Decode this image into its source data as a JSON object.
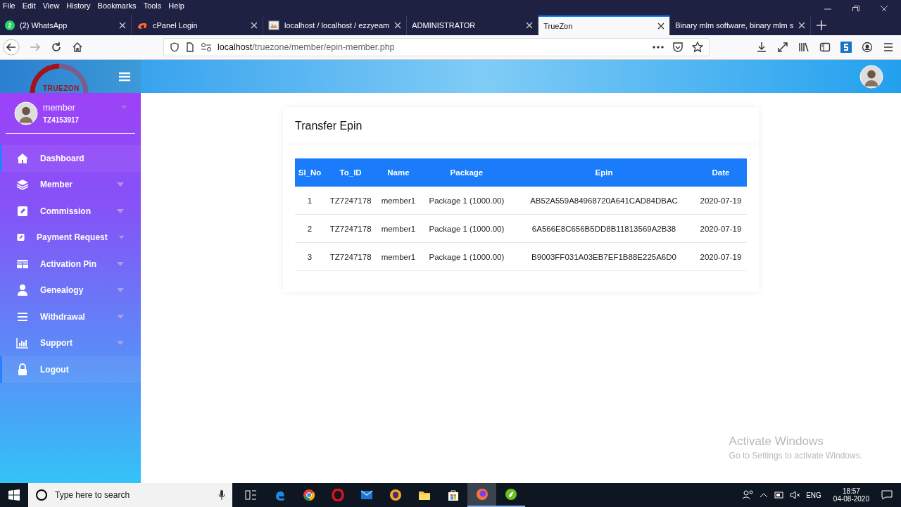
{
  "browser": {
    "menu": [
      "File",
      "Edit",
      "View",
      "History",
      "Bookmarks",
      "Tools",
      "Help"
    ],
    "tabs": [
      {
        "title": "(2) WhatsApp",
        "badge": "2",
        "selected": false
      },
      {
        "title": "cPanel Login",
        "selected": false
      },
      {
        "title": "localhost / localhost / ezzyeam",
        "selected": false
      },
      {
        "title": "ADMINISTRATOR",
        "selected": false
      },
      {
        "title": "TrueZon",
        "selected": true
      },
      {
        "title": "Binary mlm software, binary mlm s",
        "selected": false
      }
    ],
    "url": {
      "host": "localhost",
      "path": "/truezone/member/epin-member.php"
    }
  },
  "app": {
    "logo": "TRUEZON",
    "user": {
      "name": "member",
      "id": "TZ4153917"
    },
    "nav": [
      {
        "label": "Dashboard",
        "highlighted": true,
        "has_submenu": false
      },
      {
        "label": "Member",
        "highlighted": false,
        "has_submenu": true
      },
      {
        "label": "Commission",
        "highlighted": false,
        "has_submenu": true
      },
      {
        "label": "Payment Request",
        "highlighted": false,
        "has_submenu": true
      },
      {
        "label": "Activation Pin",
        "highlighted": false,
        "has_submenu": true
      },
      {
        "label": "Genealogy",
        "highlighted": false,
        "has_submenu": true
      },
      {
        "label": "Withdrawal",
        "highlighted": false,
        "has_submenu": true
      },
      {
        "label": "Support",
        "highlighted": false,
        "has_submenu": true
      },
      {
        "label": "Logout",
        "highlighted": true,
        "has_submenu": false
      }
    ],
    "card": {
      "title": "Transfer Epin",
      "table": {
        "columns": [
          "Sl_No",
          "To_ID",
          "Name",
          "Package",
          "Epin",
          "Date"
        ],
        "rows": [
          [
            "1",
            "TZ7247178",
            "member1",
            "Package 1 (1000.00)",
            "AB52A559A84968720A641CAD84DBAC",
            "2020-07-19"
          ],
          [
            "2",
            "TZ7247178",
            "member1",
            "Package 1 (1000.00)",
            "6A566E8C656B5DD8B11813569A2B38",
            "2020-07-19"
          ],
          [
            "3",
            "TZ7247178",
            "member1",
            "Package 1 (1000.00)",
            "B9003FF031A03EB7EF1B88E225A6D0",
            "2020-07-19"
          ]
        ]
      }
    }
  },
  "activation_notice": {
    "title": "Activate Windows",
    "text": "Go to Settings to activate Windows."
  },
  "taskbar": {
    "search_placeholder": "Type here to search",
    "language": "ENG",
    "time": "18:57",
    "date": "04-08-2020"
  }
}
